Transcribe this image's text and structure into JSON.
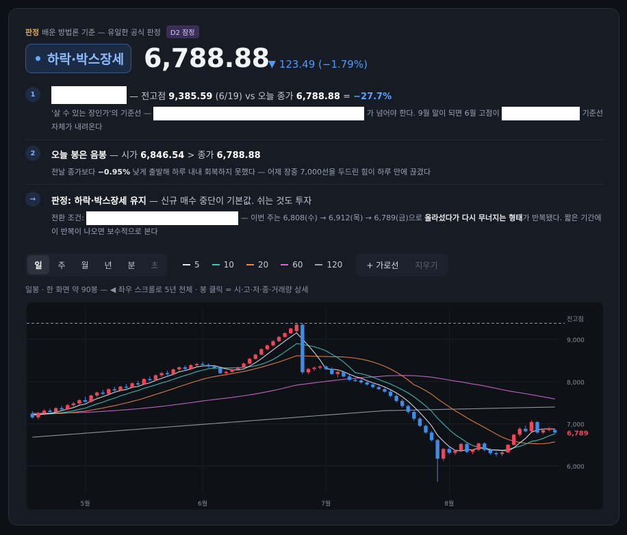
{
  "header": {
    "verdict_tag": "판정",
    "subtitle": "배운 방법론 기준 — 유일한 공식 판정",
    "badge": "D2 잠정",
    "status_label": "하락·박스장세",
    "price": "6,788.88",
    "change_arrow": "▼",
    "change_text": "123.49 (−1.79%)"
  },
  "points": [
    {
      "num": "1",
      "title_mid": "— 전고점",
      "title_v1": "9,385.59",
      "title_date": "(6/19) vs 오늘 종가",
      "title_v2": "6,788.88",
      "title_eq": "=",
      "title_pct": "−27.7%",
      "body_a": "'살 수 있는 장인가'의 기준선 —",
      "body_b": "가 넘어야 한다. 9월 말이 되면 6월 고점이",
      "body_c": "기준선 자체가 내려온다"
    },
    {
      "num": "2",
      "title_b": "오늘 봉은 음봉",
      "title_mid": "— 시가",
      "title_v1": "6,846.54",
      "title_gt": "> 종가",
      "title_v2": "6,788.88",
      "body_a": "전날 종가보다",
      "body_pct": "−0.95%",
      "body_b": "낮게 출발해 하루 내내 회복하지 못했다 — 어제 장중 7,000선을 두드린 힘이 하루 만에 끊겼다"
    },
    {
      "num": "→",
      "title_b": "판정: 하락·박스장세 유지",
      "title_rest": "— 신규 매수 중단이 기본값. 쉬는 것도 투자",
      "body_a": "전환 조건:",
      "body_b": "— 이번 주는 6,808(수) → 6,912(목) → 6,789(금)으로",
      "body_bold": "올라섰다가 다시 무너지는 형태",
      "body_c": "가 반복됐다. 짧은 기간에 이 반복이 나오면 보수적으로 본다"
    }
  ],
  "controls": {
    "timeframes": [
      "일",
      "주",
      "월",
      "년",
      "분",
      "초"
    ],
    "moving_averages": [
      {
        "label": "5",
        "color": "#e8eaee"
      },
      {
        "label": "10",
        "color": "#3fc9c3"
      },
      {
        "label": "20",
        "color": "#f08a4b"
      },
      {
        "label": "60",
        "color": "#d36ad6"
      },
      {
        "label": "120",
        "color": "#9ca3ad"
      }
    ],
    "hline_button": "+ 가로선",
    "clear_button": "지우기"
  },
  "hint": "일봉 · 한 화면 약 90봉 — ◀ 좌우 스크롤로 5년 전체 · 봉 클릭 = 시·고·저·종·거래량 상세",
  "colors": {
    "up": "#f0465a",
    "down": "#3f8ce8",
    "accent": "#6aa7ff"
  },
  "chart_data": {
    "type": "candlestick",
    "y_ticks": [
      "9,000",
      "8,000",
      "7,000",
      "6,000"
    ],
    "y_tick_values": [
      9000,
      8000,
      7000,
      6000
    ],
    "ylim": [
      5300,
      9750
    ],
    "x_labels": [
      "5월",
      "6월",
      "7월",
      "8월"
    ],
    "x_label_index": [
      9,
      29,
      50,
      71
    ],
    "prev_high_label": "전고점",
    "prev_high": 9385.59,
    "last_price_label": "6,789",
    "last_price": 6788.88,
    "candles": [
      [
        7240,
        7300,
        7120,
        7150
      ],
      [
        7150,
        7280,
        7100,
        7250
      ],
      [
        7250,
        7340,
        7200,
        7310
      ],
      [
        7310,
        7360,
        7240,
        7280
      ],
      [
        7280,
        7390,
        7260,
        7370
      ],
      [
        7370,
        7420,
        7310,
        7340
      ],
      [
        7340,
        7470,
        7320,
        7440
      ],
      [
        7440,
        7520,
        7400,
        7480
      ],
      [
        7480,
        7580,
        7450,
        7560
      ],
      [
        7560,
        7640,
        7500,
        7520
      ],
      [
        7520,
        7690,
        7500,
        7670
      ],
      [
        7670,
        7760,
        7630,
        7740
      ],
      [
        7740,
        7800,
        7680,
        7710
      ],
      [
        7710,
        7840,
        7690,
        7820
      ],
      [
        7820,
        7880,
        7760,
        7790
      ],
      [
        7790,
        7900,
        7770,
        7880
      ],
      [
        7880,
        7940,
        7840,
        7860
      ],
      [
        7860,
        7980,
        7840,
        7960
      ],
      [
        7960,
        8020,
        7900,
        7930
      ],
      [
        7930,
        8080,
        7910,
        8060
      ],
      [
        8060,
        8120,
        8010,
        8040
      ],
      [
        8040,
        8170,
        8020,
        8150
      ],
      [
        8150,
        8230,
        8110,
        8200
      ],
      [
        8200,
        8260,
        8140,
        8180
      ],
      [
        8180,
        8310,
        8160,
        8290
      ],
      [
        8290,
        8360,
        8250,
        8340
      ],
      [
        8340,
        8380,
        8280,
        8300
      ],
      [
        8300,
        8410,
        8280,
        8390
      ],
      [
        8390,
        8440,
        8350,
        8420
      ],
      [
        8420,
        8470,
        8370,
        8400
      ],
      [
        8400,
        8430,
        8330,
        8360
      ],
      [
        8360,
        8400,
        8290,
        8320
      ],
      [
        8320,
        8360,
        8180,
        8200
      ],
      [
        8200,
        8260,
        8150,
        8230
      ],
      [
        8230,
        8310,
        8210,
        8290
      ],
      [
        8290,
        8360,
        8270,
        8340
      ],
      [
        8340,
        8450,
        8320,
        8430
      ],
      [
        8430,
        8560,
        8410,
        8540
      ],
      [
        8540,
        8660,
        8520,
        8640
      ],
      [
        8640,
        8790,
        8620,
        8770
      ],
      [
        8770,
        8880,
        8740,
        8860
      ],
      [
        8860,
        8980,
        8830,
        8960
      ],
      [
        8960,
        9080,
        8940,
        9060
      ],
      [
        9060,
        9170,
        9040,
        9150
      ],
      [
        9150,
        9280,
        9130,
        9260
      ],
      [
        9200,
        9385,
        9150,
        9350
      ],
      [
        9350,
        9380,
        8180,
        8220
      ],
      [
        8220,
        8320,
        8180,
        8300
      ],
      [
        8300,
        8360,
        8260,
        8330
      ],
      [
        8330,
        8390,
        8290,
        8360
      ],
      [
        8360,
        8380,
        8280,
        8300
      ],
      [
        8300,
        8340,
        8160,
        8180
      ],
      [
        8180,
        8260,
        8100,
        8230
      ],
      [
        8230,
        8250,
        8100,
        8120
      ],
      [
        8120,
        8160,
        8020,
        8040
      ],
      [
        8040,
        8080,
        7990,
        8030
      ],
      [
        8030,
        8060,
        7950,
        7980
      ],
      [
        7980,
        8040,
        7900,
        7930
      ],
      [
        7930,
        7980,
        7840,
        7870
      ],
      [
        7870,
        7900,
        7800,
        7820
      ],
      [
        7820,
        7860,
        7740,
        7760
      ],
      [
        7760,
        7800,
        7630,
        7660
      ],
      [
        7660,
        7700,
        7500,
        7540
      ],
      [
        7540,
        7580,
        7380,
        7420
      ],
      [
        7420,
        7450,
        7240,
        7280
      ],
      [
        7280,
        7320,
        7070,
        7120
      ],
      [
        7120,
        7150,
        6920,
        6950
      ],
      [
        6950,
        6980,
        6760,
        6790
      ],
      [
        6790,
        6830,
        6580,
        6610
      ],
      [
        6610,
        6640,
        5620,
        6170
      ],
      [
        6170,
        6420,
        6120,
        6400
      ],
      [
        6400,
        6450,
        6280,
        6310
      ],
      [
        6310,
        6380,
        6260,
        6360
      ],
      [
        6360,
        6540,
        6330,
        6520
      ],
      [
        6520,
        6550,
        6300,
        6330
      ],
      [
        6330,
        6400,
        6270,
        6380
      ],
      [
        6380,
        6550,
        6350,
        6530
      ],
      [
        6530,
        6560,
        6340,
        6380
      ],
      [
        6380,
        6420,
        6260,
        6300
      ],
      [
        6300,
        6340,
        6220,
        6280
      ],
      [
        6280,
        6340,
        6230,
        6320
      ],
      [
        6320,
        6520,
        6300,
        6500
      ],
      [
        6500,
        6760,
        6480,
        6740
      ],
      [
        6740,
        6920,
        6700,
        6880
      ],
      [
        6880,
        6960,
        6800,
        6820
      ],
      [
        6820,
        7080,
        6790,
        7040
      ],
      [
        7040,
        7060,
        6760,
        6790
      ],
      [
        6790,
        6880,
        6760,
        6850
      ],
      [
        6850,
        6930,
        6820,
        6890
      ],
      [
        6850,
        6880,
        6760,
        6789
      ]
    ]
  }
}
